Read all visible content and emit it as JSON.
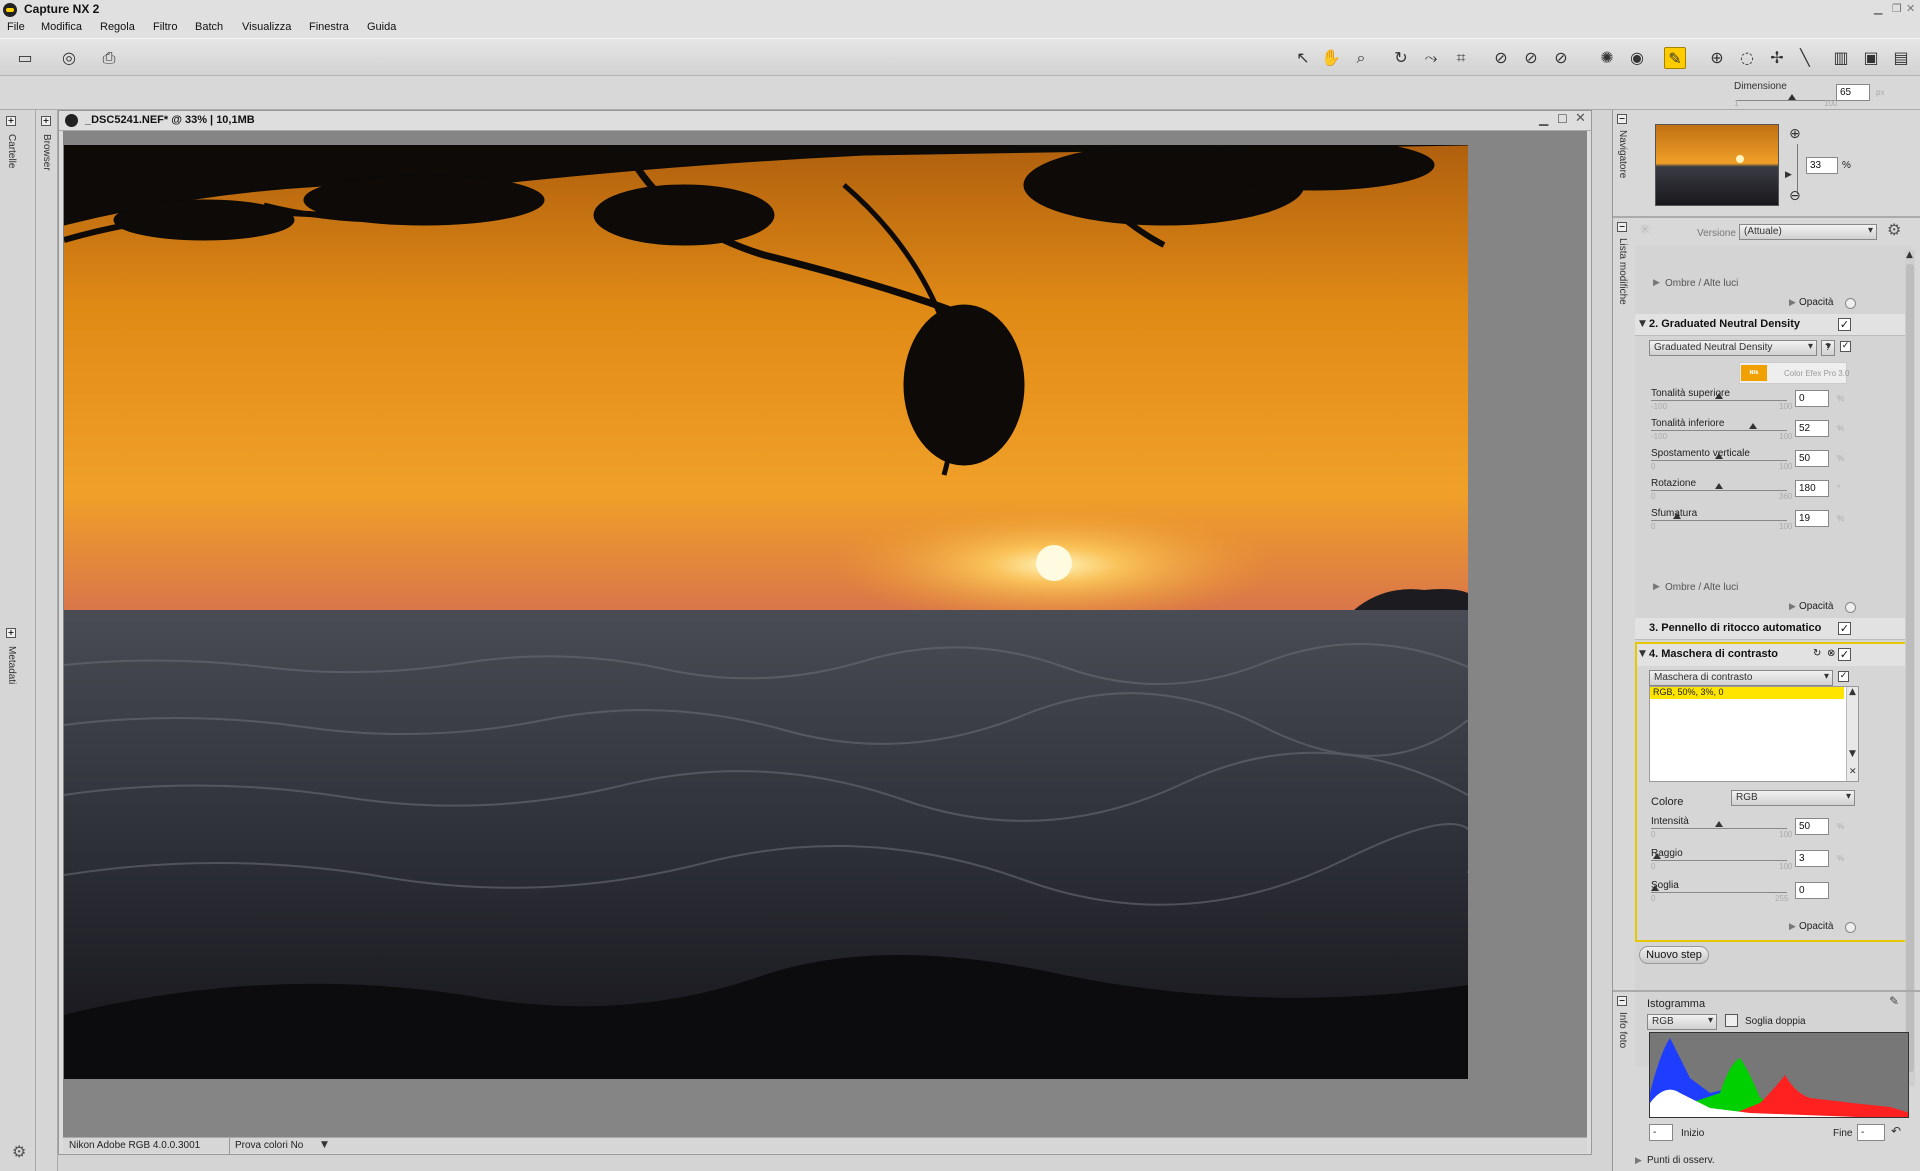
{
  "app": {
    "title": "Capture NX 2"
  },
  "menu": [
    "File",
    "Modifica",
    "Regola",
    "Filtro",
    "Batch",
    "Visualizza",
    "Finestra",
    "Guida"
  ],
  "options_bar": {
    "dimension_label": "Dimensione",
    "dimension_value": "65",
    "dimension_unit": "px",
    "min": "1",
    "max": "100"
  },
  "left_tabs": {
    "cartelle": "Cartelle",
    "browser": "Browser",
    "metadati": "Metadati"
  },
  "document": {
    "title": "_DSC5241.NEF* @ 33% | 10,1MB",
    "profile": "Nikon Adobe RGB 4.0.0.3001",
    "proof": "Prova colori No"
  },
  "navigator": {
    "tab": "Navigatore",
    "zoom": "33",
    "zoom_unit": "%"
  },
  "edit_list": {
    "tab": "Lista modifiche",
    "version_label": "Versione",
    "version_value": "(Attuale)",
    "shadows_label": "Ombre / Alte luci",
    "opacity_label": "Opacità",
    "step2": {
      "title": "2. Graduated Neutral Density",
      "filter": "Graduated Neutral Density",
      "help": "?",
      "vendor_logo": "Nik Software",
      "vendor": "Color Efex Pro 3.0",
      "params": [
        {
          "label": "Tonalità superiore",
          "min": "-100",
          "max": "100",
          "value": "0",
          "unit": "%"
        },
        {
          "label": "Tonalità inferiore",
          "min": "-100",
          "max": "100",
          "value": "52",
          "unit": "%"
        },
        {
          "label": "Spostamento verticale",
          "min": "0",
          "max": "100",
          "value": "50",
          "unit": "%"
        },
        {
          "label": "Rotazione",
          "min": "0",
          "max": "360",
          "value": "180",
          "unit": "°"
        },
        {
          "label": "Sfumatura",
          "min": "0",
          "max": "100",
          "value": "19",
          "unit": "%"
        }
      ]
    },
    "step3": {
      "title": "3. Pennello di ritocco automatico"
    },
    "step4": {
      "title": "4. Maschera di contrasto",
      "filter": "Maschera di contrasto",
      "list_item": "RGB, 50%, 3%, 0",
      "colore_label": "Colore",
      "colore_value": "RGB",
      "params": [
        {
          "label": "Intensità",
          "min": "0",
          "max": "100",
          "value": "50",
          "unit": "%"
        },
        {
          "label": "Raggio",
          "min": "0",
          "max": "100",
          "value": "3",
          "unit": "%"
        },
        {
          "label": "Soglia",
          "min": "0",
          "max": "255",
          "value": "0",
          "unit": ""
        }
      ]
    },
    "new_step": "Nuovo step"
  },
  "photo_info": {
    "tab": "Info foto",
    "histogram_label": "Istogramma",
    "channel": "RGB",
    "double_threshold": "Soglia doppia",
    "start_label": "Inizio",
    "start_value": "-",
    "end_label": "Fine",
    "end_value": "-",
    "watch_points": "Punti di osserv."
  }
}
